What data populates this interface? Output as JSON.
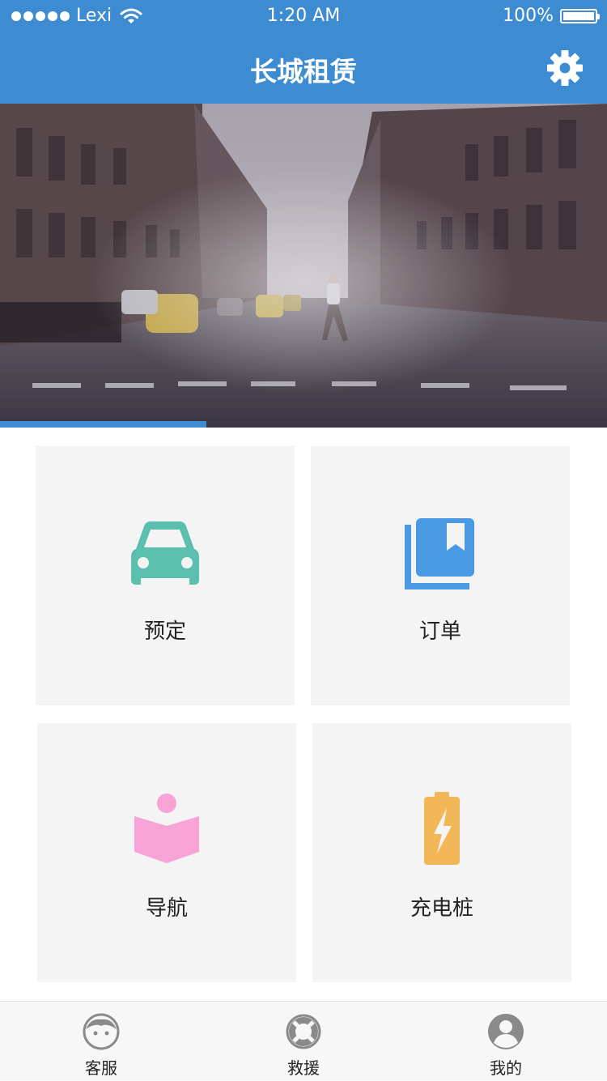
{
  "status_bar": {
    "carrier": "Lexi",
    "time": "1:20 AM",
    "battery": "100%"
  },
  "header": {
    "title": "长城租赁",
    "settings_icon": "gear-icon"
  },
  "banner": {
    "carousel_progress": 0.34
  },
  "tiles": [
    {
      "label": "预定",
      "icon": "car-icon",
      "color": "#5bbfae"
    },
    {
      "label": "订单",
      "icon": "bookmark-icon",
      "color": "#4a9ae3"
    },
    {
      "label": "导航",
      "icon": "reader-book-icon",
      "color": "#f7a3d6"
    },
    {
      "label": "充电桩",
      "icon": "battery-bolt-icon",
      "color": "#f2b858"
    }
  ],
  "tab_bar": [
    {
      "label": "客服",
      "icon": "face-icon"
    },
    {
      "label": "救援",
      "icon": "lifebuoy-icon"
    },
    {
      "label": "我的",
      "icon": "user-icon"
    }
  ],
  "colors": {
    "brand": "#3d8bd0",
    "tile_bg": "#f4f4f4",
    "tab_icon": "#8a8a8a"
  }
}
